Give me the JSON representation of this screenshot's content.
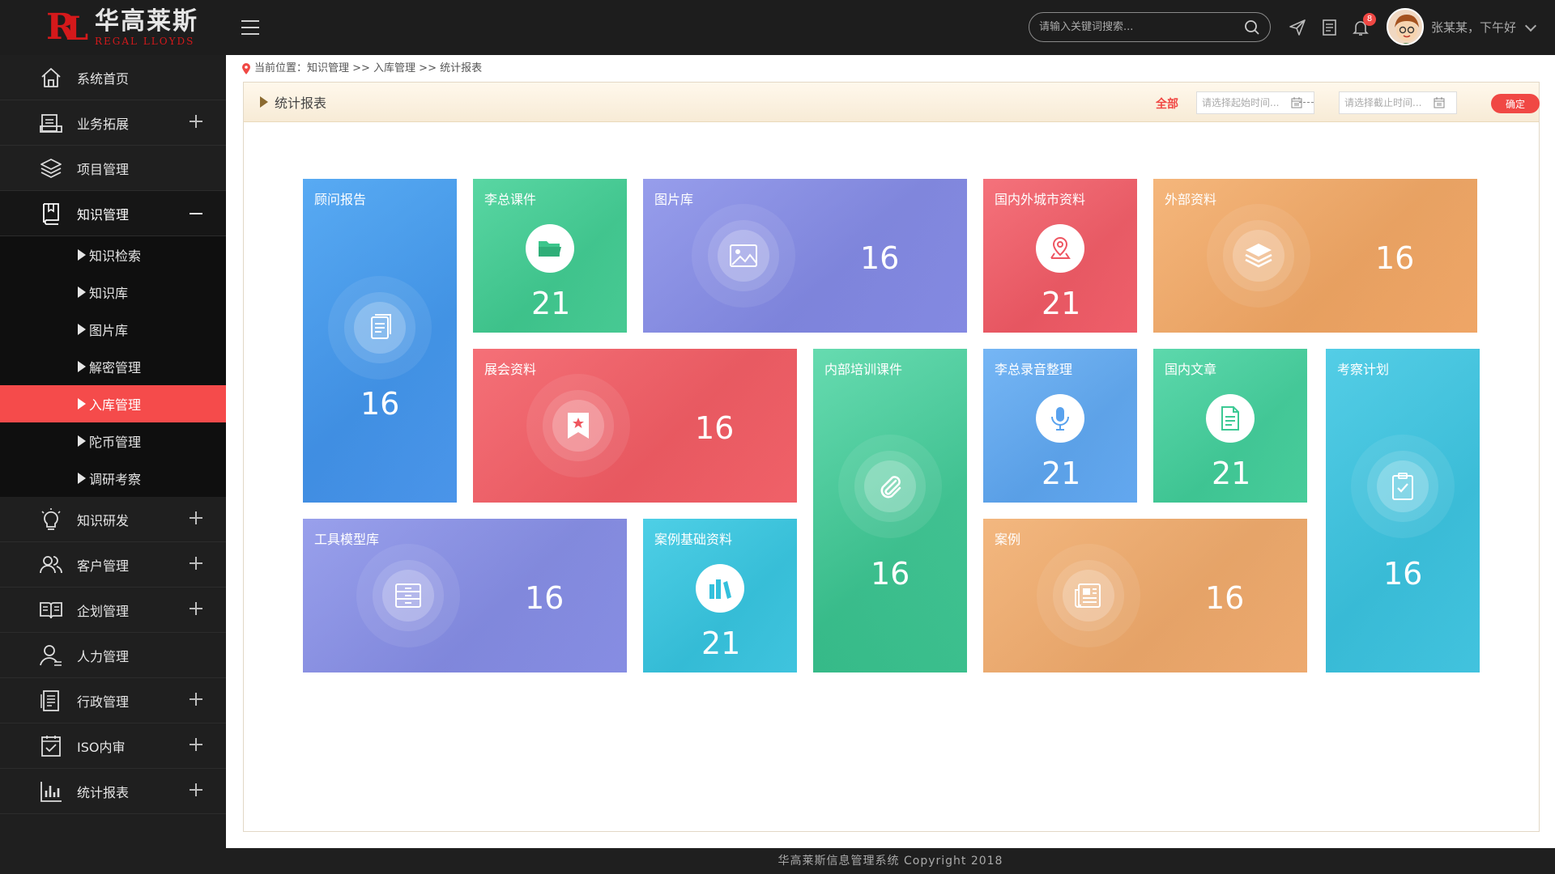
{
  "header": {
    "logo_cn": "华高莱斯",
    "logo_en": "REGAL LLOYDS",
    "search_placeholder": "请输入关键词搜索...",
    "notification_count": "8",
    "greeting": "张某某，下午好"
  },
  "sidebar": {
    "items": [
      {
        "label": "系统首页",
        "icon": "home-icon",
        "expand": "none"
      },
      {
        "label": "业务拓展",
        "icon": "briefcase-icon",
        "expand": "plus"
      },
      {
        "label": "项目管理",
        "icon": "layers-icon",
        "expand": "none"
      },
      {
        "label": "知识管理",
        "icon": "book-icon",
        "expand": "minus"
      },
      {
        "label": "知识研发",
        "icon": "bulb-icon",
        "expand": "plus"
      },
      {
        "label": "客户管理",
        "icon": "users-icon",
        "expand": "plus"
      },
      {
        "label": "企划管理",
        "icon": "open-book-icon",
        "expand": "plus"
      },
      {
        "label": "人力管理",
        "icon": "person-icon",
        "expand": "none"
      },
      {
        "label": "行政管理",
        "icon": "document-icon",
        "expand": "plus"
      },
      {
        "label": "ISO内审",
        "icon": "checklist-icon",
        "expand": "plus"
      },
      {
        "label": "统计报表",
        "icon": "bar-chart-icon",
        "expand": "plus"
      }
    ],
    "sub_items": [
      "知识检索",
      "知识库",
      "图片库",
      "解密管理",
      "入库管理",
      "陀币管理",
      "调研考察"
    ],
    "active_sub": "入库管理"
  },
  "breadcrumb": "当前位置：知识管理 >> 入库管理 >> 统计报表",
  "panel": {
    "title": "统计报表",
    "filter_all": "全部",
    "start_placeholder": "请选择起始时间...",
    "end_placeholder": "请选择截止时间...",
    "confirm": "确定"
  },
  "tiles": [
    {
      "title": "顾问报告",
      "value": "16",
      "icon": "files-icon",
      "color": "#4a9ef0"
    },
    {
      "title": "李总课件",
      "value": "21",
      "icon": "folder-icon",
      "color": "#45cf97"
    },
    {
      "title": "图片库",
      "value": "16",
      "icon": "image-icon",
      "color": "#8a8fe6"
    },
    {
      "title": "国内外城市资料",
      "value": "21",
      "icon": "map-pin-icon",
      "color": "#f0606a"
    },
    {
      "title": "外部资料",
      "value": "16",
      "icon": "stack-icon",
      "color": "#f0a865"
    },
    {
      "title": "展会资料",
      "value": "16",
      "icon": "bookmark-icon",
      "color": "#f06068"
    },
    {
      "title": "内部培训课件",
      "value": "16",
      "icon": "paperclip-icon",
      "color": "#3fcd94"
    },
    {
      "title": "李总录音整理",
      "value": "21",
      "icon": "microphone-icon",
      "color": "#5ea8f0"
    },
    {
      "title": "国内文章",
      "value": "21",
      "icon": "article-icon",
      "color": "#3fd09c"
    },
    {
      "title": "考察计划",
      "value": "16",
      "icon": "clipboard-check-icon",
      "color": "#3dc5e0"
    },
    {
      "title": "工具模型库",
      "value": "16",
      "icon": "drawer-icon",
      "color": "#8a8fe6"
    },
    {
      "title": "案例基础资料",
      "value": "21",
      "icon": "books-icon",
      "color": "#38c6e0"
    },
    {
      "title": "案例",
      "value": "16",
      "icon": "newspaper-icon",
      "color": "#f0a866"
    }
  ],
  "footer": "华高莱斯信息管理系统    Copyright  2018"
}
